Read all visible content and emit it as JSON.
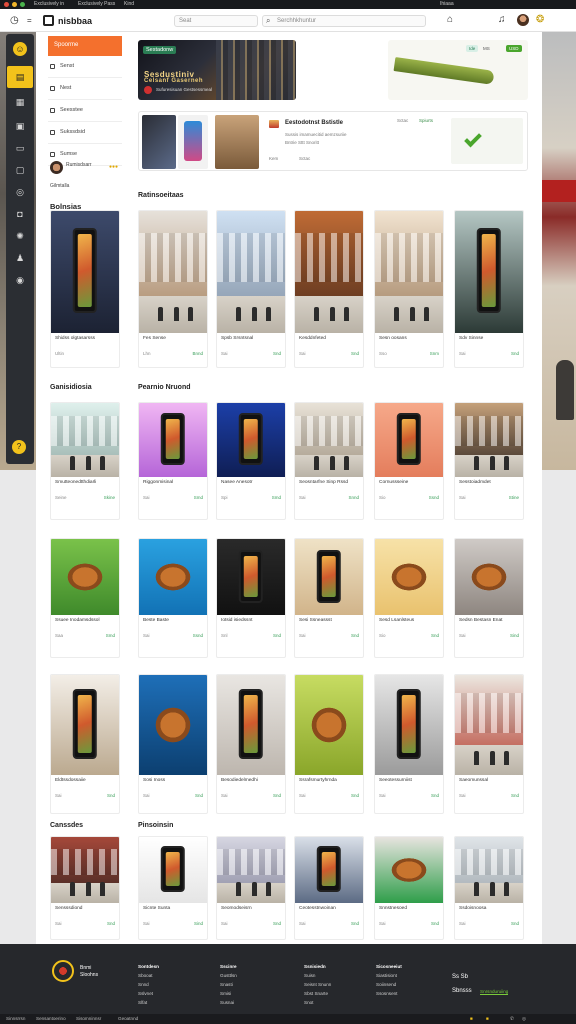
{
  "topbar": {
    "items": [
      "Exclusively in",
      "Exclusively Pass",
      "Kind"
    ],
    "right": "Ihiaaa"
  },
  "header": {
    "brand": "nisbbaa",
    "search_short": "Seat",
    "search_long": "Serchhkhuntur"
  },
  "nav": {
    "head": "Spoorme",
    "items": [
      "Senst",
      "Nest",
      "Seesstee",
      "Sukssdsid",
      "Sumse"
    ],
    "promo": "Rumisdsarr",
    "more": "Gilmtalla"
  },
  "banners": {
    "primary_tag": "Sestadonw",
    "primary_headline": "Sesdustiniv",
    "primary_headline_2": "Celsanf Gaserneh",
    "primary_sub": "Sufuresisuan Gestsessmeal",
    "secondary_tags": [
      "Ide",
      "MS",
      "USD"
    ]
  },
  "feature": {
    "title": "Eestodotnst Bstistle",
    "lines": [
      "Sussis imamuecitid aemzsuriie",
      "Bntrie Sttt Snoritt"
    ],
    "tags": [
      "Kem",
      "Sctac",
      "Spiurts"
    ]
  },
  "sections": {
    "main_title": "Ratinsoeitaas",
    "side_title": "Bolnsias",
    "row2_side_title": "Ganisidiosia",
    "row2_title": "Pearnio Nruond",
    "row5_side_title": "Canssdes",
    "row5_title": "Pinsoinsin"
  },
  "rows": [
    [
      {
        "title": "Shidss olgtasarsss",
        "meta": "Ultin",
        "rating": ""
      },
      {
        "title": "Fes Sense",
        "meta": "Lhn",
        "rating": "Bnnd"
      },
      {
        "title": "Spsb Srsntsnal",
        "meta": "Sai",
        "rating": "Snd"
      },
      {
        "title": "Kesddnfeted",
        "meta": "Sai",
        "rating": "Snd"
      },
      {
        "title": "Sesn oosans",
        "meta": "Sso",
        "rating": "Snm"
      },
      {
        "title": "Sdv Sinnse",
        "meta": "Sai",
        "rating": "Snd"
      }
    ],
    [
      {
        "title": "Smutteonedtthdiarli",
        "meta": "Seine",
        "rating": "Skine"
      },
      {
        "title": "Riggonmisinal",
        "meta": "Sai",
        "rating": "Smd"
      },
      {
        "title": "Nasee Anesotr",
        "meta": "Spi",
        "rating": "Smd"
      },
      {
        "title": "Seosntarfne Sinp Rssd",
        "meta": "Sai",
        "rating": "Snnd"
      },
      {
        "title": "Cornussseine",
        "meta": "Sio",
        "rating": "Ssnd"
      },
      {
        "title": "Sesstoiadmdet",
        "meta": "Sai",
        "rating": "Stine"
      }
    ],
    [
      {
        "title": "Ssuee Inodamsdssol",
        "meta": "Saa",
        "rating": "Smd"
      },
      {
        "title": "Beste Baste",
        "meta": "Sai",
        "rating": "Ssnd"
      },
      {
        "title": "Iotsid isiedssnt",
        "meta": "Snl",
        "rating": "Snd"
      },
      {
        "title": "Sesi Ssneassst",
        "meta": "Sai",
        "rating": "Snd"
      },
      {
        "title": "Sesd Lsanlsteus",
        "meta": "Sio",
        "rating": "Snd"
      },
      {
        "title": "Sedsn Bestasn Enat",
        "meta": "Sai",
        "rating": "Sind"
      }
    ],
    [
      {
        "title": "Eldtssdossaiie",
        "meta": "Sai",
        "rating": "Snd"
      },
      {
        "title": "Sosi Inoss",
        "meta": "Sai",
        "rating": "Snd"
      },
      {
        "title": "Besodiedelmedhi",
        "meta": "Sai",
        "rating": "Snd"
      },
      {
        "title": "Ssrafsmurtyhrnda",
        "meta": "Sai",
        "rating": "Snd"
      },
      {
        "title": "Seeotessurniist",
        "meta": "Sai",
        "rating": "Snd"
      },
      {
        "title": "Saeomunssal",
        "meta": "Sai",
        "rating": "Snd"
      }
    ],
    [
      {
        "title": "Sensssdiond",
        "meta": "Sai",
        "rating": "Snd"
      },
      {
        "title": "Sicnte Sunta",
        "meta": "Sai",
        "rating": "Sind"
      },
      {
        "title": "Seomodseisrn",
        "meta": "Sai",
        "rating": "Snd"
      },
      {
        "title": "Ceotesstnwoinan",
        "meta": "Sai",
        "rating": "Snd"
      },
      {
        "title": "Snnstnesoed",
        "meta": "Sai",
        "rating": "Snd"
      },
      {
        "title": "Ssdoisnoosa",
        "meta": "Sai",
        "rating": "Snd"
      }
    ]
  ],
  "footer": {
    "brand_lines": [
      "Bnmi",
      "Sloohns"
    ],
    "cols": [
      {
        "head": "Sontdesn",
        "items": [
          "Sbooat",
          "Snnd",
          "Sslvnet",
          "Slfat"
        ]
      },
      {
        "head": "Sscinre",
        "items": [
          "Gusttlsn",
          "Snasti",
          "Smisi",
          "Susnai"
        ]
      },
      {
        "head": "Ssnisiedn",
        "items": [
          "Suisn",
          "Seisnt Snunn",
          "Sbst Snarte",
          "Snot"
        ]
      },
      {
        "head": "Sicosneeiut",
        "items": [
          "Siastisiont",
          "Soiinsend",
          "Ssosnsent"
        ]
      }
    ],
    "app_labels": [
      "Ss Sb",
      "Sbnsss"
    ],
    "app_badge": "Snrsnduruiing"
  },
  "bottombar": [
    "Sinnsrrsn",
    "Sensantoerino",
    "Sisomninnsr",
    "Geoatnnd"
  ],
  "colors": {
    "accent": "#f2c21b",
    "brand": "#f4702d",
    "rail": "#2b2e33",
    "footer": "#26282c",
    "positive": "#3a9f5a"
  }
}
